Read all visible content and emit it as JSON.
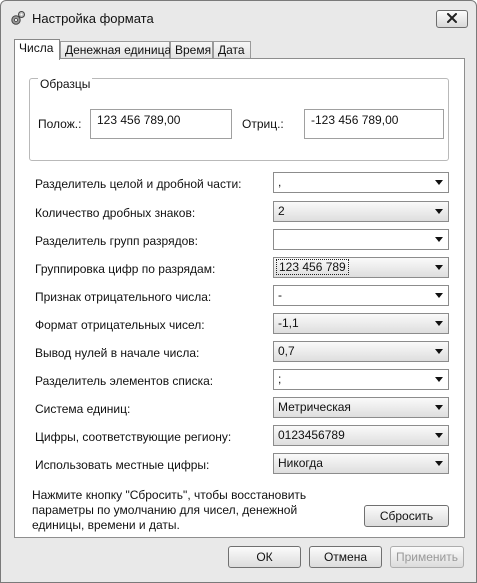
{
  "window": {
    "title": "Настройка формата"
  },
  "tabs": [
    {
      "label": "Числа",
      "active": true
    },
    {
      "label": "Денежная единица",
      "active": false
    },
    {
      "label": "Время",
      "active": false
    },
    {
      "label": "Дата",
      "active": false
    }
  ],
  "samples": {
    "title": "Образцы",
    "positive_label": "Полож.:",
    "positive_value": "123 456 789,00",
    "negative_label": "Отриц.:",
    "negative_value": "-123 456 789,00"
  },
  "settings": [
    {
      "label": "Разделитель целой и дробной части:",
      "value": ",",
      "style": "editable"
    },
    {
      "label": "Количество дробных знаков:",
      "value": "2",
      "style": "dropdown"
    },
    {
      "label": "Разделитель групп разрядов:",
      "value": "",
      "style": "editable"
    },
    {
      "label": "Группировка цифр по разрядам:",
      "value": "123 456 789",
      "style": "dropdown",
      "focused": true
    },
    {
      "label": "Признак отрицательного числа:",
      "value": "-",
      "style": "editable"
    },
    {
      "label": "Формат отрицательных чисел:",
      "value": "-1,1",
      "style": "dropdown"
    },
    {
      "label": "Вывод нулей в начале числа:",
      "value": "0,7",
      "style": "dropdown"
    },
    {
      "label": "Разделитель элементов списка:",
      "value": ";",
      "style": "editable"
    },
    {
      "label": "Система единиц:",
      "value": "Метрическая",
      "style": "dropdown"
    },
    {
      "label": "Цифры, соответствующие региону:",
      "value": "0123456789",
      "style": "dropdown"
    },
    {
      "label": "Использовать местные цифры:",
      "value": "Никогда",
      "style": "dropdown"
    }
  ],
  "reset": {
    "text": "Нажмите кнопку \"Сбросить\", чтобы восстановить параметры по умолчанию для чисел, денежной единицы, времени и даты.",
    "button": "Сбросить"
  },
  "footer": {
    "ok": "ОК",
    "cancel": "Отмена",
    "apply": "Применить",
    "apply_enabled": false
  },
  "icons": {
    "app": "gear-icon",
    "close": "close-icon",
    "dropdown": "chevron-down-icon"
  }
}
